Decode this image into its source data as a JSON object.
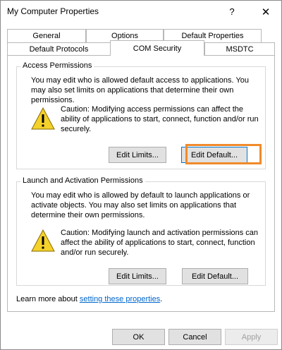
{
  "window": {
    "title": "My Computer Properties",
    "help_glyph": "?",
    "close_glyph": "✕"
  },
  "tabs": {
    "row1": [
      "General",
      "Options",
      "Default Properties"
    ],
    "row2": [
      "Default Protocols",
      "COM Security",
      "MSDTC"
    ],
    "active": "COM Security"
  },
  "access": {
    "legend": "Access Permissions",
    "description": "You may edit who is allowed default access to applications. You may also set limits on applications that determine their own permissions.",
    "caution": "Caution: Modifying access permissions can affect the ability of applications to start, connect, function and/or run securely.",
    "edit_limits": "Edit Limits...",
    "edit_default": "Edit Default..."
  },
  "launch": {
    "legend": "Launch and Activation Permissions",
    "description": "You may edit who is allowed by default to launch applications or activate objects. You may also set limits on applications that determine their own permissions.",
    "caution": "Caution: Modifying launch and activation permissions can affect the ability of applications to start, connect, function and/or run securely.",
    "edit_limits": "Edit Limits...",
    "edit_default": "Edit Default..."
  },
  "learn": {
    "prefix": "Learn more about ",
    "link": "setting these properties",
    "suffix": "."
  },
  "footer": {
    "ok": "OK",
    "cancel": "Cancel",
    "apply": "Apply"
  },
  "colors": {
    "highlight": "#f08a2b",
    "link": "#0066cc",
    "warning_yellow": "#f4d12b"
  }
}
